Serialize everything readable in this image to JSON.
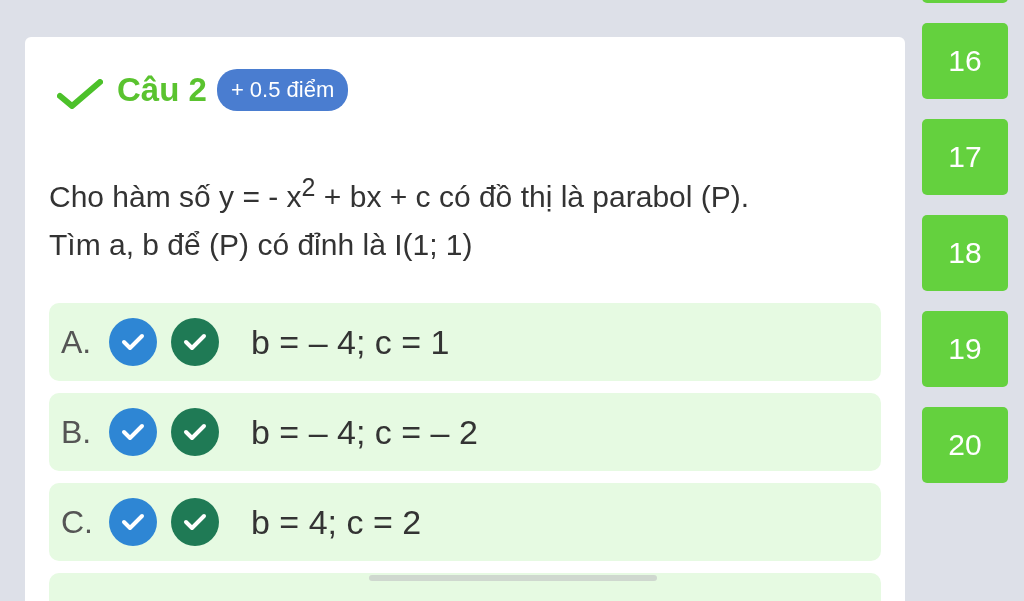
{
  "question": {
    "correct": true,
    "title": "Câu 2",
    "points": "+ 0.5 điểm",
    "text_lines": [
      "Cho hàm số y = - x$^{2}$ + bx + c có đồ thị là parabol (P).",
      "Tìm a, b để (P) có đỉnh là I(1; 1)"
    ],
    "options": [
      {
        "letter": "A.",
        "text": "b = – 4; c = 1"
      },
      {
        "letter": "B.",
        "text": "b = – 4; c = – 2"
      },
      {
        "letter": "C.",
        "text": "b = 4; c = 2"
      }
    ]
  },
  "question_numbers": [
    {
      "label": "16"
    },
    {
      "label": "17"
    },
    {
      "label": "18"
    },
    {
      "label": "19"
    },
    {
      "label": "20"
    }
  ]
}
